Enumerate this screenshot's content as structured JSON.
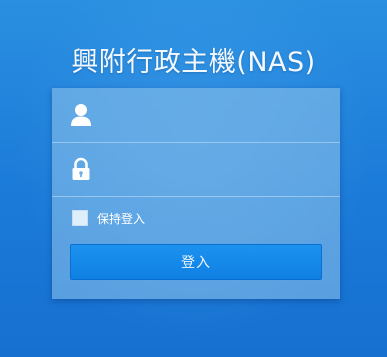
{
  "title": "興附行政主機(NAS)",
  "form": {
    "username": {
      "icon": "user-icon",
      "value": "",
      "placeholder": ""
    },
    "password": {
      "icon": "lock-icon",
      "value": "",
      "placeholder": ""
    },
    "remember_label": "保持登入",
    "remember_checked": false,
    "submit_label": "登入"
  },
  "colors": {
    "background": "#1b7ad8",
    "panel": "#92c4eb",
    "button": "#1589ea",
    "text": "#ffffff"
  }
}
